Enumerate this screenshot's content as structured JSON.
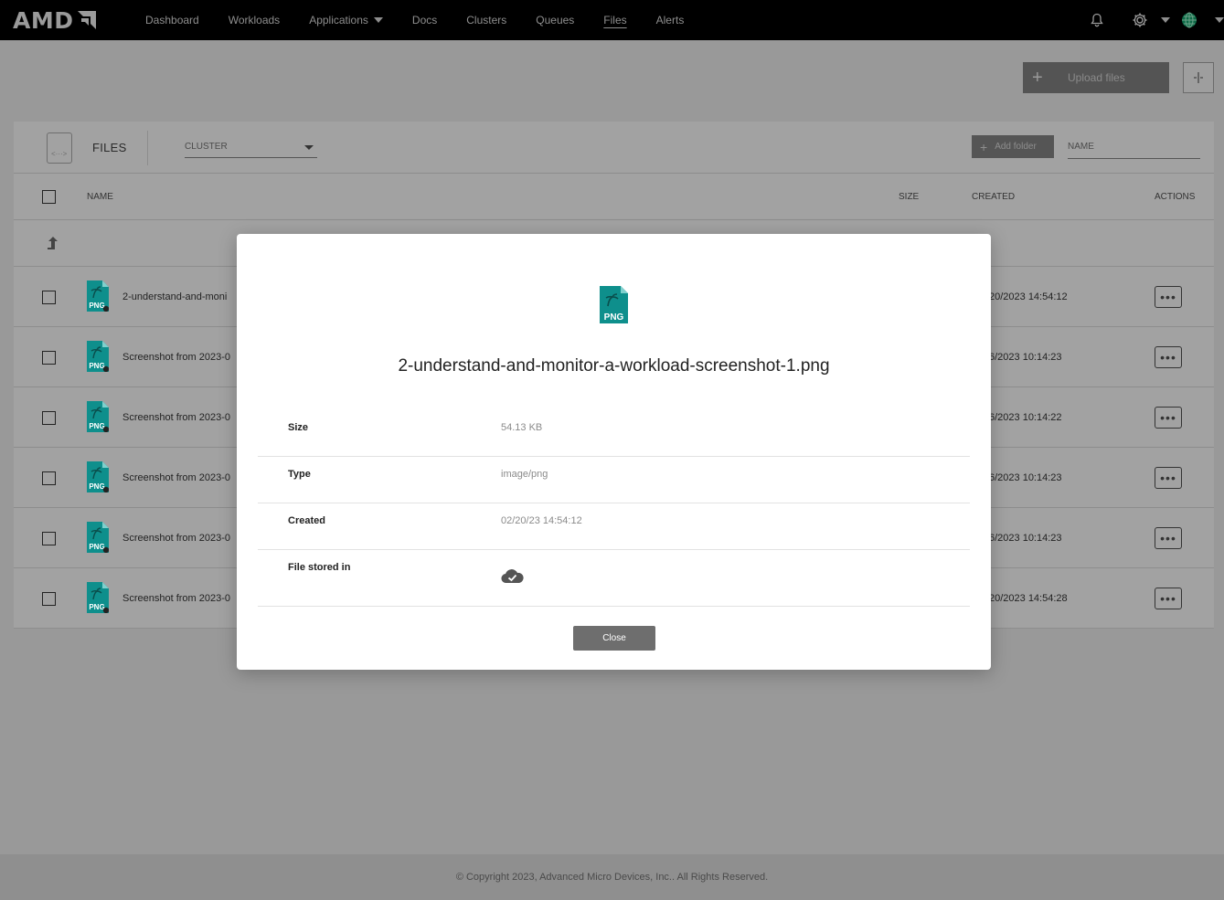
{
  "brand": {
    "logo_text": "AMD"
  },
  "nav": {
    "items": [
      {
        "label": "Dashboard"
      },
      {
        "label": "Workloads"
      },
      {
        "label": "Applications"
      },
      {
        "label": "Docs"
      },
      {
        "label": "Clusters"
      },
      {
        "label": "Queues"
      },
      {
        "label": "Files"
      },
      {
        "label": "Alerts"
      }
    ],
    "active": "Files"
  },
  "toolbar": {
    "upload_label": "Upload files"
  },
  "files_panel": {
    "title": "FILES",
    "cluster_placeholder": "CLUSTER",
    "add_folder_label": "Add folder",
    "name_placeholder": "NAME",
    "columns": {
      "name": "NAME",
      "size": "SIZE",
      "created": "CREATED",
      "actions": "ACTIONS"
    },
    "rows": [
      {
        "name": "2-understand-and-moni",
        "created": "20/2023 14:54:12",
        "icon": "PNG"
      },
      {
        "name": "Screenshot from 2023-0",
        "created": "6/2023 10:14:23",
        "icon": "PNG"
      },
      {
        "name": "Screenshot from 2023-0",
        "created": "6/2023 10:14:22",
        "icon": "PNG"
      },
      {
        "name": "Screenshot from 2023-0",
        "created": "6/2023 10:14:23",
        "icon": "PNG"
      },
      {
        "name": "Screenshot from 2023-0",
        "created": "6/2023 10:14:23",
        "icon": "PNG"
      },
      {
        "name": "Screenshot from 2023-0",
        "created": "20/2023 14:54:28",
        "icon": "PNG"
      }
    ],
    "actions_glyph": "•••"
  },
  "modal": {
    "icon_label": "PNG",
    "filename": "2-understand-and-monitor-a-workload-screenshot-1.png",
    "details": [
      {
        "label": "Size",
        "value": "54.13 KB"
      },
      {
        "label": "Type",
        "value": "image/png"
      },
      {
        "label": "Created",
        "value": "02/20/23 14:54:12"
      },
      {
        "label": "File stored in",
        "value_icon": "cloud-check-icon"
      }
    ],
    "close_label": "Close"
  },
  "footer": {
    "text": "© Copyright 2023, Advanced Micro Devices, Inc.. All Rights Reserved."
  },
  "colors": {
    "png_teal": "#0e8f8c",
    "overlay": "#999999",
    "topbar": "#000000"
  }
}
